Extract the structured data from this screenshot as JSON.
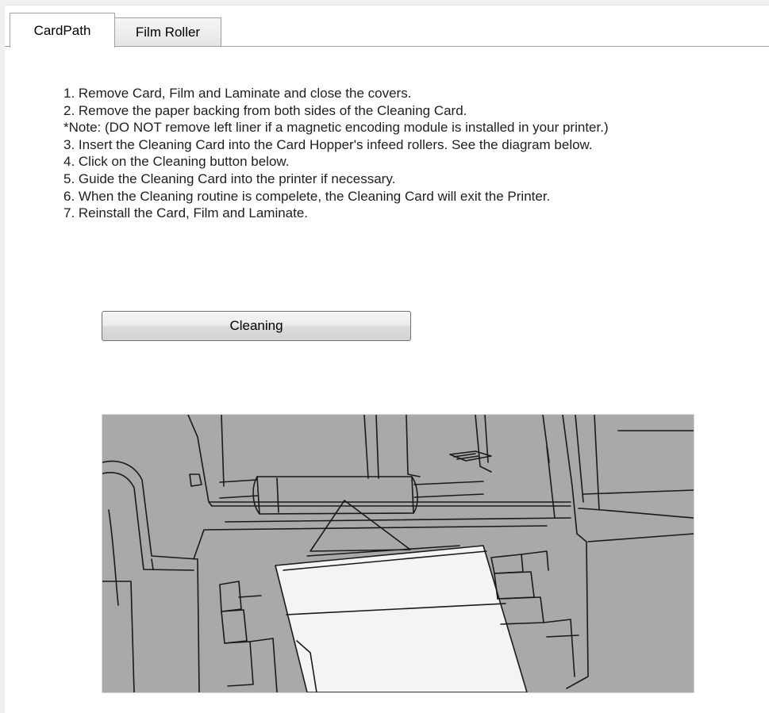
{
  "tabs": [
    {
      "label": "CardPath",
      "active": true
    },
    {
      "label": "Film Roller",
      "active": false
    }
  ],
  "instructions": [
    "1. Remove Card, Film and Laminate and close the covers.",
    "2. Remove the paper backing from both sides of the Cleaning Card.",
    "*Note: (DO NOT remove left liner if a magnetic encoding module is installed in your printer.)",
    "3. Insert the Cleaning Card into the Card Hopper's infeed rollers. See the diagram below.",
    "4. Click on the Cleaning button below.",
    "5. Guide the Cleaning Card into the printer if necessary.",
    "6. When the Cleaning routine is compelete, the Cleaning Card will exit the Printer.",
    "7. Reinstall the Card, Film and Laminate."
  ],
  "cleaning_button": {
    "label": "Cleaning"
  },
  "diagram": {
    "subject": "card-hopper-infeed-with-cleaning-card",
    "colors": {
      "body": "#a9a9a9",
      "card": "#f4f4f4",
      "line": "#1a1a1a"
    }
  }
}
